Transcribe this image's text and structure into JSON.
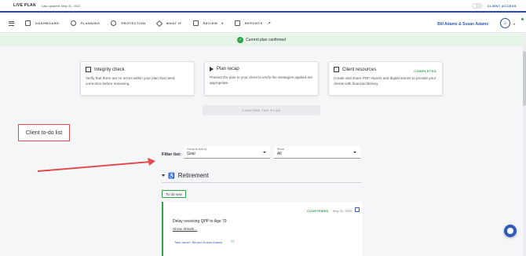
{
  "topbar": {
    "live_plan": "LIVE PLAN",
    "last_updated": "Last updated: May 31, 2022",
    "client_access": "CLIENT ACCESS"
  },
  "nav": {
    "items": [
      {
        "label": "DASHBOARD",
        "icon": "dashboard-icon"
      },
      {
        "label": "PLANNING",
        "icon": "planning-icon"
      },
      {
        "label": "PROTECTION",
        "icon": "shield-icon"
      },
      {
        "label": "WHAT IF",
        "icon": "whatif-icon"
      },
      {
        "label": "REVIEW",
        "icon": "review-icon"
      },
      {
        "label": "REPORTS",
        "icon": "reports-icon"
      }
    ],
    "user_name": "Bill Adams & Susan Adams"
  },
  "banner": {
    "text": "Current plan confirmed"
  },
  "cards": [
    {
      "title": "Integrity check",
      "desc": "Verify that there are no errors within your plan that need correction before reviewing.",
      "badge": ""
    },
    {
      "title": "Plan recap",
      "desc": "Present the plan to your client to verify the strategies applied are appropriate.",
      "badge": ""
    },
    {
      "title": "Client resources",
      "desc": "Create and share PDF reports and digital stories to provide your clients with financial literacy.",
      "badge": "COMPLETED"
    }
  ],
  "confirm_button": "CONFIRM THE PLAN",
  "annotation_label": "Client to-do list",
  "filter": {
    "label": "Filter list:",
    "group_caption": "Group to-dos by",
    "group_value": "Goal",
    "show_caption": "Show",
    "show_value": "All"
  },
  "section": {
    "title": "Retirement"
  },
  "todo_chip": "To do now",
  "task": {
    "status": "CONFIRMED",
    "date": "May 31, 2022",
    "title": "Delay receiving QPP to Age 70",
    "show_details": "Show details...",
    "owner": "Task owner: Bill and Susan Adams"
  },
  "colors": {
    "brand_blue": "#2f4b9a",
    "accent_green": "#2fa24a",
    "annotation_red": "#e14c4c"
  }
}
